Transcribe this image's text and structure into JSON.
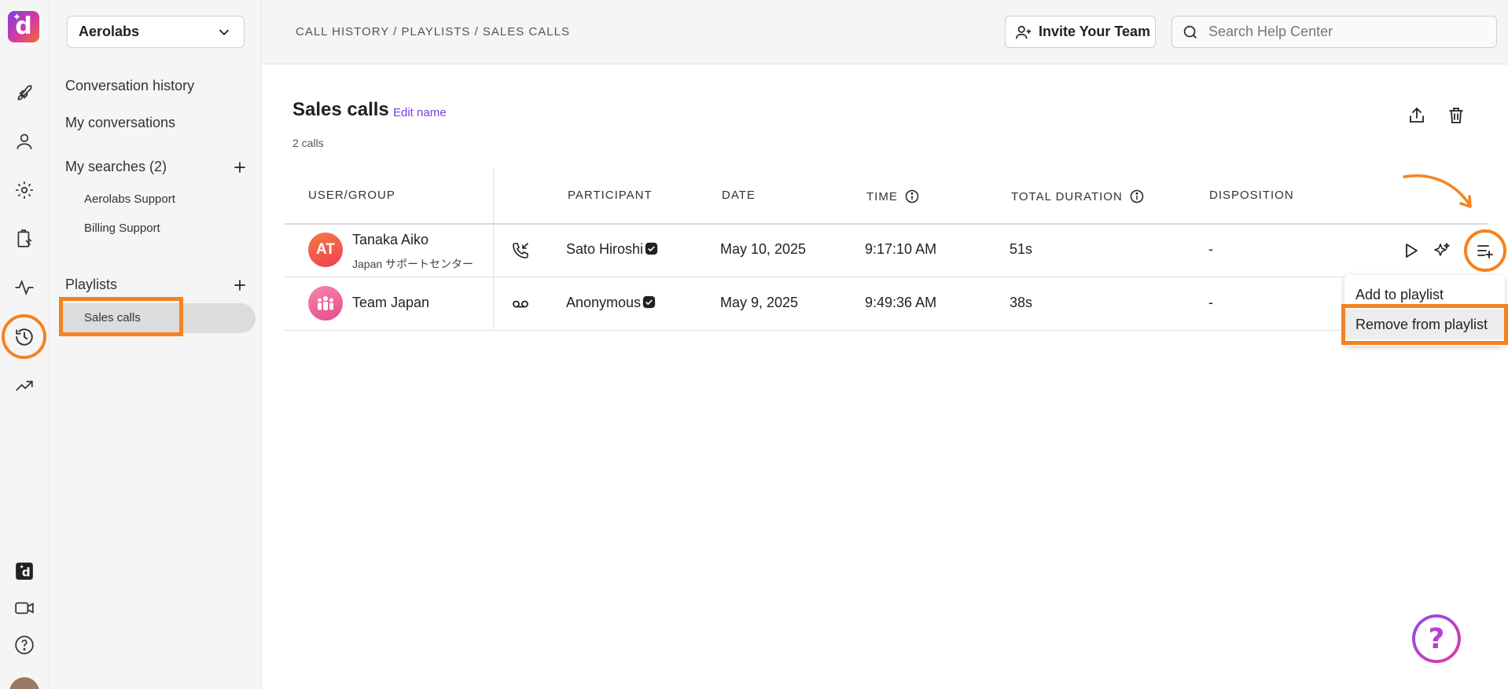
{
  "app": {
    "logo_letter": "d"
  },
  "workspace": {
    "name": "Aerolabs"
  },
  "nav": {
    "conversation_history": "Conversation history",
    "my_conversations": "My conversations",
    "my_searches": "My searches (2)",
    "searches": [
      "Aerolabs Support",
      "Billing Support"
    ],
    "playlists": "Playlists",
    "playlist_items": [
      "Sales calls"
    ]
  },
  "header": {
    "breadcrumb": "CALL HISTORY / PLAYLISTS / SALES CALLS",
    "invite_label": "Invite Your Team",
    "search_placeholder": "Search Help Center"
  },
  "page": {
    "title": "Sales calls",
    "edit_name": "Edit name",
    "count": "2 calls"
  },
  "table": {
    "headers": {
      "user_group": "USER/GROUP",
      "participant": "PARTICIPANT",
      "date": "DATE",
      "time": "TIME",
      "total_duration": "TOTAL DURATION",
      "disposition": "DISPOSITION"
    },
    "rows": [
      {
        "initials": "AT",
        "name": "Tanaka Aiko",
        "sub": "Japan サポートセンター",
        "call_type": "incoming-call-icon",
        "participant": "Sato Hiroshi",
        "date": "May 10, 2025",
        "time": "9:17:10 AM",
        "duration": "51s",
        "disposition": "-"
      },
      {
        "initials": "",
        "name": "Team Japan",
        "sub": "",
        "call_type": "voicemail-icon",
        "participant": "Anonymous",
        "date": "May 9, 2025",
        "time": "9:49:36 AM",
        "duration": "38s",
        "disposition": "-"
      }
    ]
  },
  "menu": {
    "items": [
      "Add to playlist",
      "Remove from playlist"
    ]
  },
  "help": {
    "label": "?"
  },
  "colors": {
    "accent": "#7a3fd9",
    "highlight": "#f58220"
  }
}
